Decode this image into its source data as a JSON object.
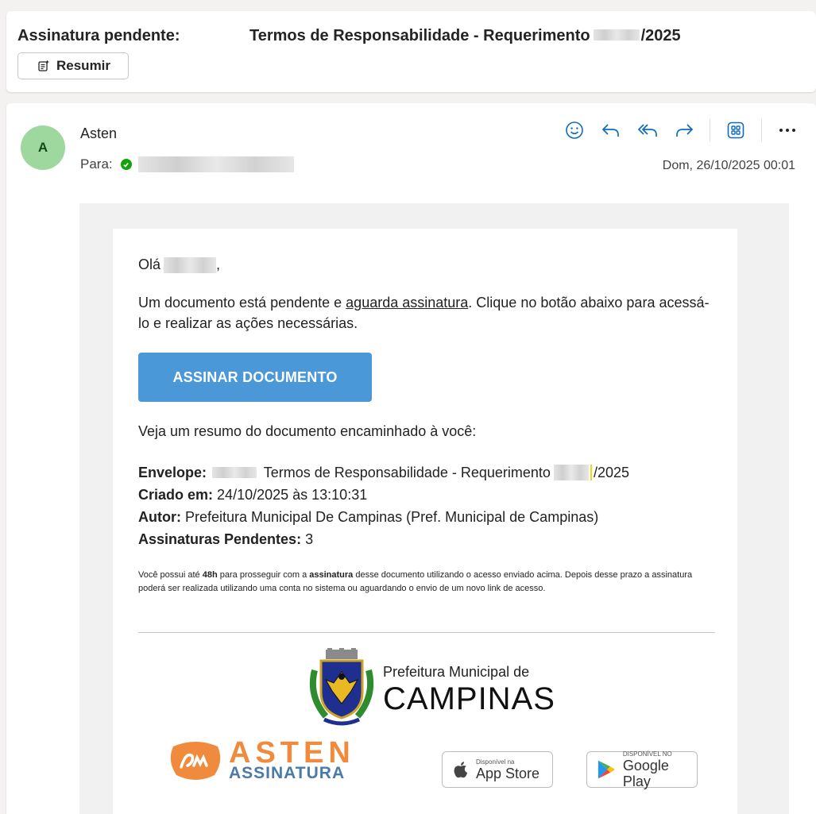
{
  "subject": {
    "label": "Assinatura pendente:",
    "title_prefix": "Termos de Responsabilidade - Requerimento",
    "title_suffix": "/2025",
    "summarize_label": "Resumir"
  },
  "message": {
    "avatar_initial": "A",
    "sender": "Asten",
    "to_label": "Para:",
    "date": "Dom, 26/10/2025 00:01",
    "actions": [
      "emoji-icon",
      "reply-icon",
      "reply-all-icon",
      "forward-icon",
      "apps-icon",
      "more-icon"
    ]
  },
  "email": {
    "greeting": "Olá",
    "greeting_end": ",",
    "intro_before": "Um documento está pendente e ",
    "intro_link": "aguarda assinatura",
    "intro_after": ". Clique no botão abaixo para acessá-lo e realizar as ações necessárias.",
    "cta": "ASSINAR DOCUMENTO",
    "summary_intro": "Veja um resumo do documento encaminhado à você:",
    "envelope_label": "Envelope:",
    "envelope_value": "Termos de Responsabilidade - Requerimento",
    "envelope_suffix": "/2025",
    "created_label": "Criado em:",
    "created_value": "24/10/2025 às 13:10:31",
    "author_label": "Autor:",
    "author_value": "Prefeitura Municipal De Campinas (Pref. Municipal de Campinas)",
    "pending_label": "Assinaturas Pendentes:",
    "pending_value": "3",
    "note_1": "Você possui até ",
    "note_48h": "48h",
    "note_2": " para prosseguir com a ",
    "note_sig": "assinatura",
    "note_3": " desse documento utilizando o acesso enviado acima. Depois desse prazo a assinatura poderá ser realizada utilizando uma conta no sistema ou aguardando o envio de um novo link de acesso.",
    "campinas_small": "Prefeitura Municipal de",
    "campinas_big": "CAMPINAS",
    "asten_word": "ASTEN",
    "asten_sub": "ASSINATURA",
    "appstore_small": "Disponível na",
    "appstore_big": "App Store",
    "gplay_small": "DISPONÍVEL NO",
    "gplay_big": "Google Play"
  },
  "colors": {
    "accent": "#4a98d8",
    "action_icons": "#0f6cbd",
    "avatar_bg": "#9fd89f",
    "asten_orange": "#f08a3c",
    "asten_blue": "#4a7aa8"
  }
}
